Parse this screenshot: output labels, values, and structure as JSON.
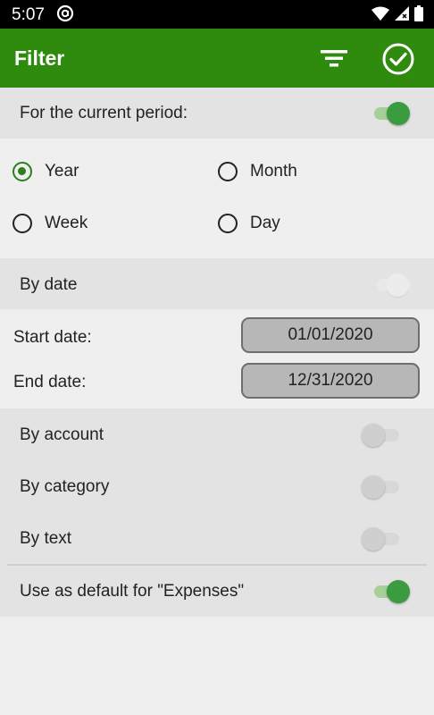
{
  "status_bar": {
    "time": "5:07"
  },
  "app_bar": {
    "title": "Filter"
  },
  "current_period": {
    "label": "For the current period:",
    "enabled": true
  },
  "period_options": [
    {
      "label": "Year",
      "selected": true
    },
    {
      "label": "Month",
      "selected": false
    },
    {
      "label": "Week",
      "selected": false
    },
    {
      "label": "Day",
      "selected": false
    }
  ],
  "by_date": {
    "label": "By date",
    "enabled": false,
    "disabled": true
  },
  "dates": {
    "start_label": "Start date:",
    "start_value": "01/01/2020",
    "end_label": "End date:",
    "end_value": "12/31/2020"
  },
  "by_account": {
    "label": "By account",
    "enabled": false
  },
  "by_category": {
    "label": "By category",
    "enabled": false
  },
  "by_text": {
    "label": "By text",
    "enabled": false
  },
  "default_expenses": {
    "label": "Use as default for \"Expenses\"",
    "enabled": true
  },
  "colors": {
    "accent": "#2e8b0e",
    "toggle_on": "#3b9b3f"
  }
}
